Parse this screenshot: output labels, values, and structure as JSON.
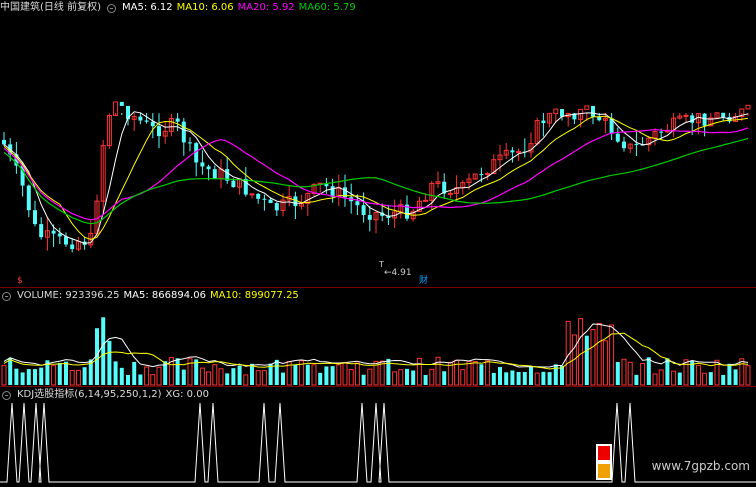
{
  "main_legend": {
    "stock": "中国建筑(日线 前复权)",
    "ma5": "MA5: 6.12",
    "ma10": "MA10: 6.06",
    "ma20": "MA20: 5.92",
    "ma60": "MA60: 5.79"
  },
  "vol_legend": {
    "volume": "VOLUME: 923396.25",
    "ma5": "MA5: 866894.06",
    "ma10": "MA10: 899077.25"
  },
  "kdj_legend": {
    "name": "KDJ选股指标(6,14,95,250,1,2)",
    "xg": "XG: 0.00"
  },
  "annotations": {
    "low_price": "←4.91",
    "low_marker": "T",
    "event_badge": "财",
    "dividend_badge": "$"
  },
  "watermark": "www.7gpzb.com",
  "colors": {
    "up": "#ff3333",
    "down": "#54fcfc",
    "ma5": "#ffffff",
    "ma10": "#ffff00",
    "ma20": "#ff00ff",
    "ma60": "#00cc00",
    "separator": "#7a0000"
  }
}
